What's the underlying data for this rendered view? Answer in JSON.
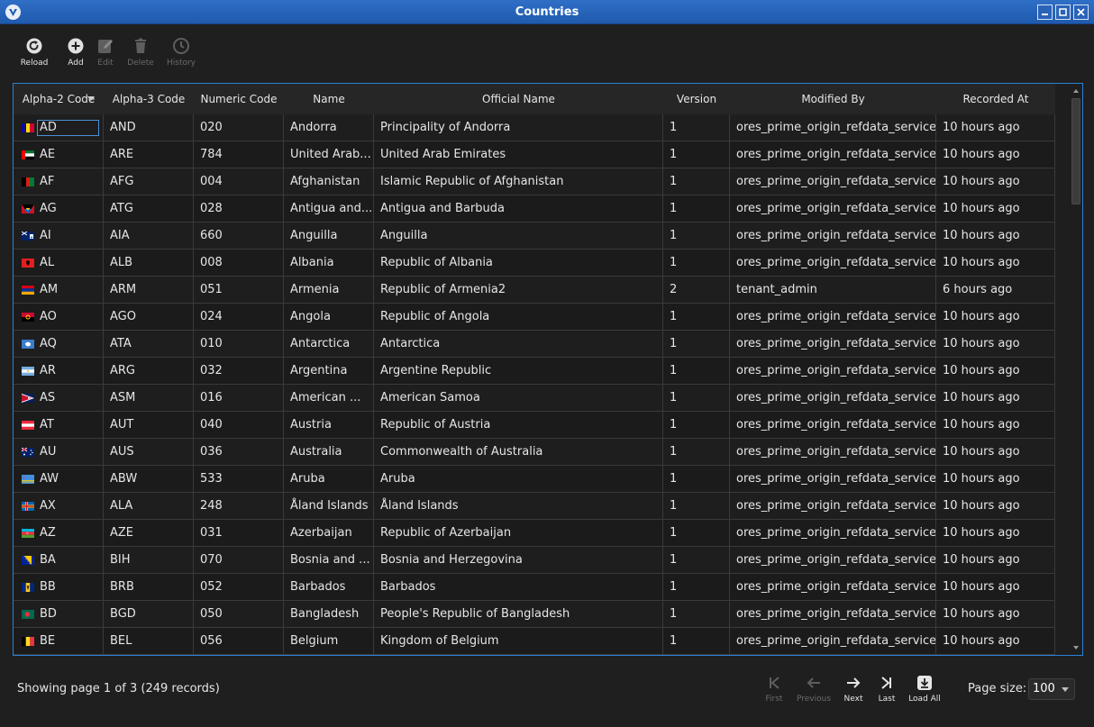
{
  "window": {
    "title": "Countries"
  },
  "toolbar": {
    "reload": "Reload",
    "add": "Add",
    "edit": "Edit",
    "delete": "Delete",
    "history": "History"
  },
  "table": {
    "columns": [
      "Alpha-2 Code",
      "Alpha-3 Code",
      "Numeric Code",
      "Name",
      "Official Name",
      "Version",
      "Modified By",
      "Recorded At"
    ],
    "rows": [
      {
        "flag": "ad",
        "alpha2": "AD",
        "alpha3": "AND",
        "numeric": "020",
        "name": "Andorra",
        "official": "Principality of Andorra",
        "version": "1",
        "modified_by": "ores_prime_origin_refdata_service",
        "recorded_at": "10 hours ago"
      },
      {
        "flag": "ae",
        "alpha2": "AE",
        "alpha3": "ARE",
        "numeric": "784",
        "name": "United Arab...",
        "official": "United Arab Emirates",
        "version": "1",
        "modified_by": "ores_prime_origin_refdata_service",
        "recorded_at": "10 hours ago"
      },
      {
        "flag": "af",
        "alpha2": "AF",
        "alpha3": "AFG",
        "numeric": "004",
        "name": "Afghanistan",
        "official": "Islamic Republic of Afghanistan",
        "version": "1",
        "modified_by": "ores_prime_origin_refdata_service",
        "recorded_at": "10 hours ago"
      },
      {
        "flag": "ag",
        "alpha2": "AG",
        "alpha3": "ATG",
        "numeric": "028",
        "name": "Antigua and...",
        "official": "Antigua and Barbuda",
        "version": "1",
        "modified_by": "ores_prime_origin_refdata_service",
        "recorded_at": "10 hours ago"
      },
      {
        "flag": "ai",
        "alpha2": "AI",
        "alpha3": "AIA",
        "numeric": "660",
        "name": "Anguilla",
        "official": "Anguilla",
        "version": "1",
        "modified_by": "ores_prime_origin_refdata_service",
        "recorded_at": "10 hours ago"
      },
      {
        "flag": "al",
        "alpha2": "AL",
        "alpha3": "ALB",
        "numeric": "008",
        "name": "Albania",
        "official": "Republic of Albania",
        "version": "1",
        "modified_by": "ores_prime_origin_refdata_service",
        "recorded_at": "10 hours ago"
      },
      {
        "flag": "am",
        "alpha2": "AM",
        "alpha3": "ARM",
        "numeric": "051",
        "name": "Armenia",
        "official": "Republic of Armenia2",
        "version": "2",
        "modified_by": "tenant_admin",
        "recorded_at": "6 hours ago"
      },
      {
        "flag": "ao",
        "alpha2": "AO",
        "alpha3": "AGO",
        "numeric": "024",
        "name": "Angola",
        "official": "Republic of Angola",
        "version": "1",
        "modified_by": "ores_prime_origin_refdata_service",
        "recorded_at": "10 hours ago"
      },
      {
        "flag": "aq",
        "alpha2": "AQ",
        "alpha3": "ATA",
        "numeric": "010",
        "name": "Antarctica",
        "official": "Antarctica",
        "version": "1",
        "modified_by": "ores_prime_origin_refdata_service",
        "recorded_at": "10 hours ago"
      },
      {
        "flag": "ar",
        "alpha2": "AR",
        "alpha3": "ARG",
        "numeric": "032",
        "name": "Argentina",
        "official": "Argentine Republic",
        "version": "1",
        "modified_by": "ores_prime_origin_refdata_service",
        "recorded_at": "10 hours ago"
      },
      {
        "flag": "as",
        "alpha2": "AS",
        "alpha3": "ASM",
        "numeric": "016",
        "name": "American ...",
        "official": "American Samoa",
        "version": "1",
        "modified_by": "ores_prime_origin_refdata_service",
        "recorded_at": "10 hours ago"
      },
      {
        "flag": "at",
        "alpha2": "AT",
        "alpha3": "AUT",
        "numeric": "040",
        "name": "Austria",
        "official": "Republic of Austria",
        "version": "1",
        "modified_by": "ores_prime_origin_refdata_service",
        "recorded_at": "10 hours ago"
      },
      {
        "flag": "au",
        "alpha2": "AU",
        "alpha3": "AUS",
        "numeric": "036",
        "name": "Australia",
        "official": "Commonwealth of Australia",
        "version": "1",
        "modified_by": "ores_prime_origin_refdata_service",
        "recorded_at": "10 hours ago"
      },
      {
        "flag": "aw",
        "alpha2": "AW",
        "alpha3": "ABW",
        "numeric": "533",
        "name": "Aruba",
        "official": "Aruba",
        "version": "1",
        "modified_by": "ores_prime_origin_refdata_service",
        "recorded_at": "10 hours ago"
      },
      {
        "flag": "ax",
        "alpha2": "AX",
        "alpha3": "ALA",
        "numeric": "248",
        "name": "Åland Islands",
        "official": "Åland Islands",
        "version": "1",
        "modified_by": "ores_prime_origin_refdata_service",
        "recorded_at": "10 hours ago"
      },
      {
        "flag": "az",
        "alpha2": "AZ",
        "alpha3": "AZE",
        "numeric": "031",
        "name": "Azerbaijan",
        "official": "Republic of Azerbaijan",
        "version": "1",
        "modified_by": "ores_prime_origin_refdata_service",
        "recorded_at": "10 hours ago"
      },
      {
        "flag": "ba",
        "alpha2": "BA",
        "alpha3": "BIH",
        "numeric": "070",
        "name": "Bosnia and ...",
        "official": "Bosnia and Herzegovina",
        "version": "1",
        "modified_by": "ores_prime_origin_refdata_service",
        "recorded_at": "10 hours ago"
      },
      {
        "flag": "bb",
        "alpha2": "BB",
        "alpha3": "BRB",
        "numeric": "052",
        "name": "Barbados",
        "official": "Barbados",
        "version": "1",
        "modified_by": "ores_prime_origin_refdata_service",
        "recorded_at": "10 hours ago"
      },
      {
        "flag": "bd",
        "alpha2": "BD",
        "alpha3": "BGD",
        "numeric": "050",
        "name": "Bangladesh",
        "official": "People's Republic of Bangladesh",
        "version": "1",
        "modified_by": "ores_prime_origin_refdata_service",
        "recorded_at": "10 hours ago"
      },
      {
        "flag": "be",
        "alpha2": "BE",
        "alpha3": "BEL",
        "numeric": "056",
        "name": "Belgium",
        "official": "Kingdom of Belgium",
        "version": "1",
        "modified_by": "ores_prime_origin_refdata_service",
        "recorded_at": "10 hours ago"
      }
    ]
  },
  "footer": {
    "status": "Showing page 1 of 3 (249 records)",
    "first": "First",
    "previous": "Previous",
    "next": "Next",
    "last": "Last",
    "load_all": "Load All",
    "page_size_label": "Page size:",
    "page_size_value": "100"
  },
  "colors": {
    "titlebar": "#2f6fc6",
    "accent_border": "#2a82da",
    "background": "#1f1f1f"
  },
  "icons": {
    "app": "app-logo-icon",
    "reload": "reload-icon",
    "add": "add-icon",
    "edit": "edit-icon",
    "delete": "delete-icon",
    "history": "history-icon",
    "first": "first-page-icon",
    "previous": "previous-page-icon",
    "next": "next-page-icon",
    "last": "last-page-icon",
    "load_all": "download-icon"
  }
}
